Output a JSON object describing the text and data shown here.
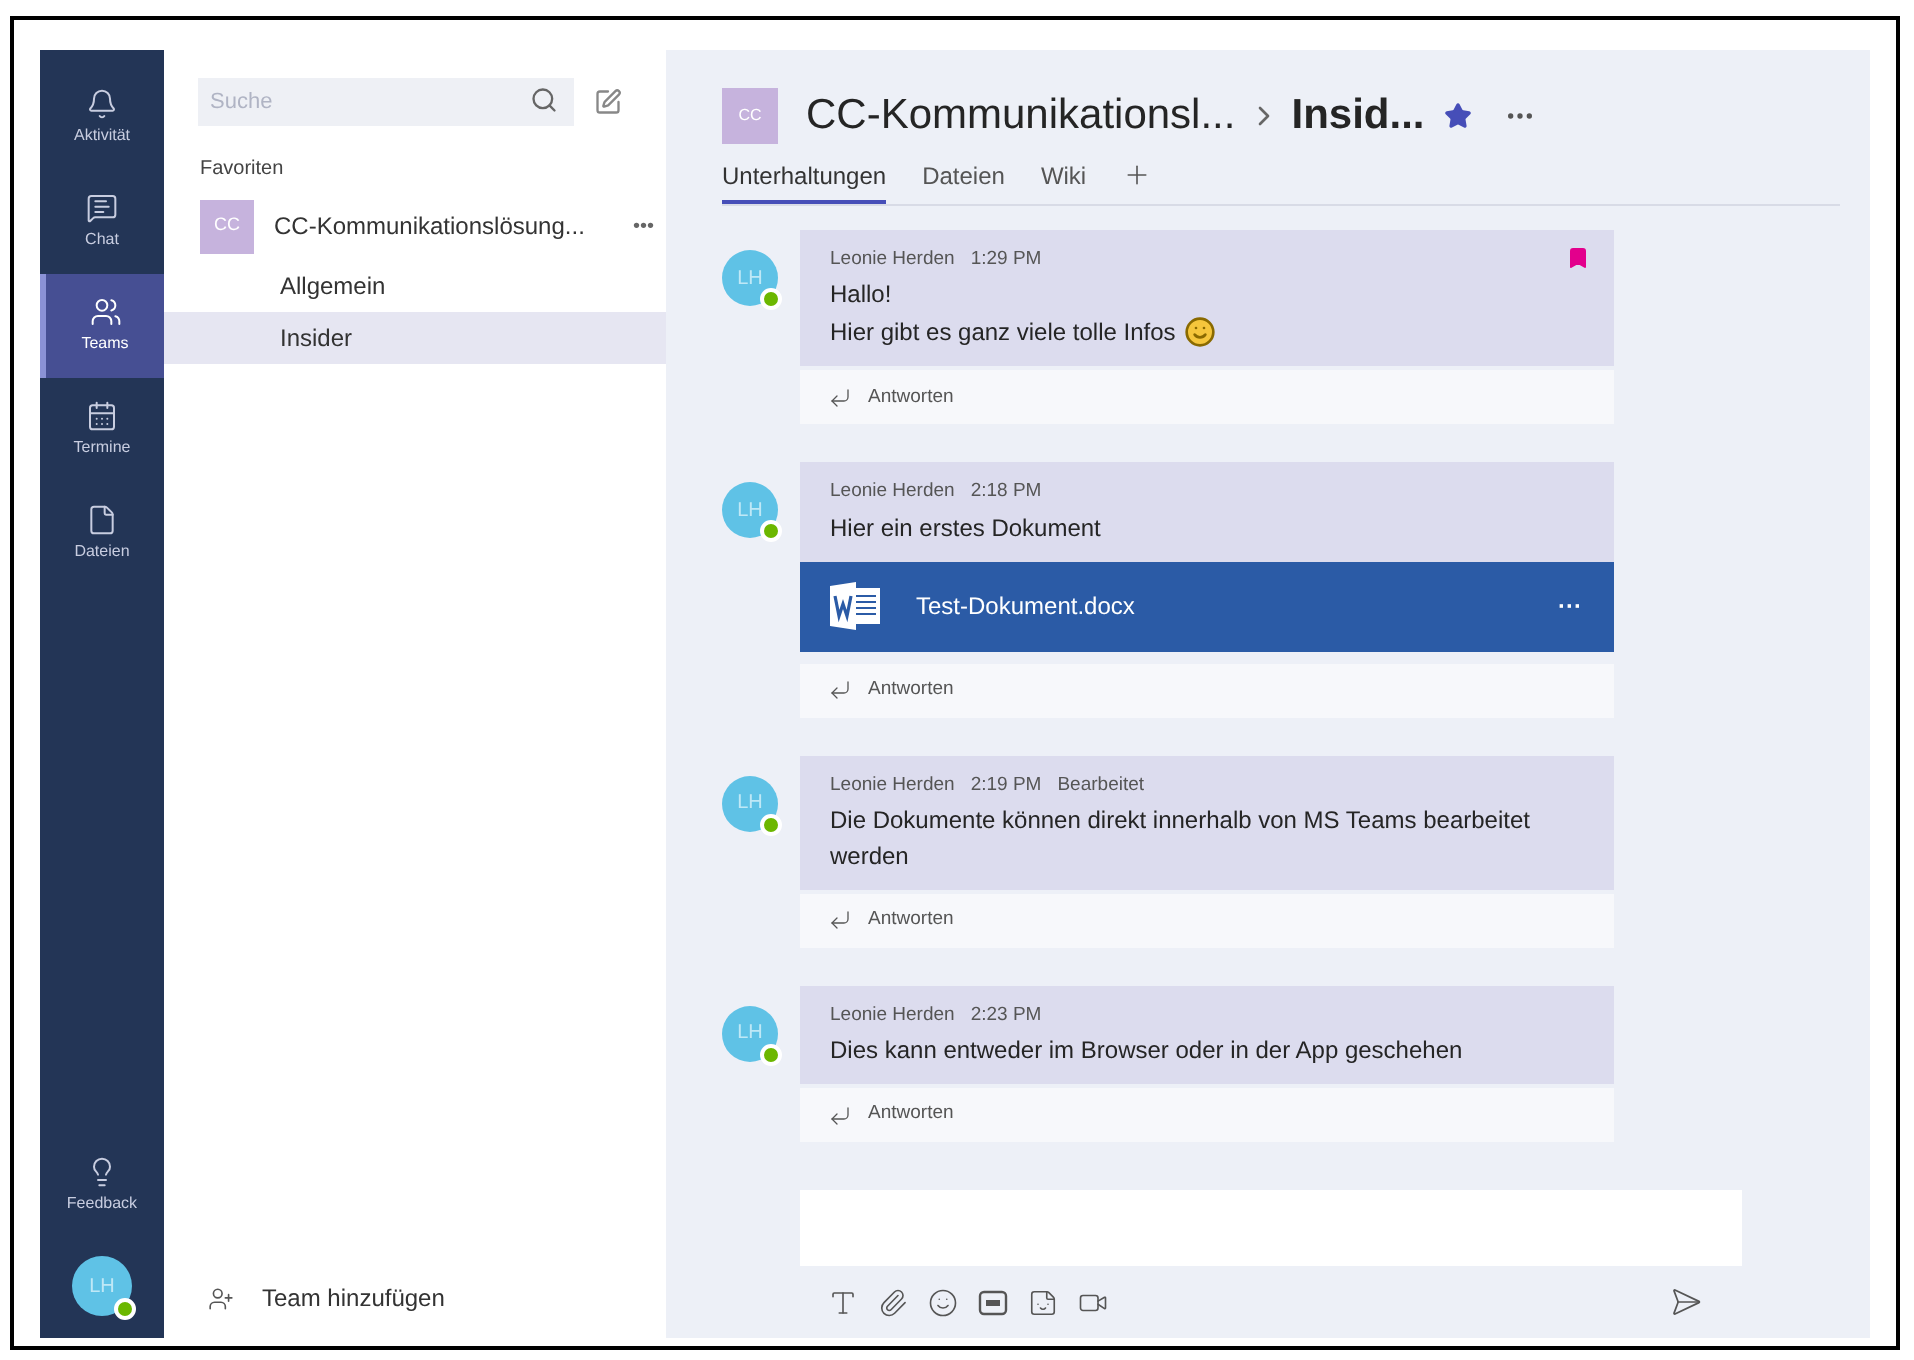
{
  "rail": {
    "items": [
      {
        "label": "Aktivität",
        "selected": false
      },
      {
        "label": "Chat",
        "selected": false
      },
      {
        "label": "Teams",
        "selected": true
      },
      {
        "label": "Termine",
        "selected": false
      },
      {
        "label": "Dateien",
        "selected": false
      }
    ],
    "feedback": "Feedback",
    "user": {
      "initials": "LH",
      "online": true
    }
  },
  "sidebar": {
    "search": {
      "placeholder": "Suche"
    },
    "section": "Favoriten",
    "team": {
      "initials": "CC",
      "name": "CC-Kommunikationslösung...",
      "more": "•••"
    },
    "channels": [
      {
        "name": "Allgemein",
        "selected": false
      },
      {
        "name": "Insider",
        "selected": true
      }
    ],
    "add_team": "Team hinzufügen"
  },
  "header": {
    "initials": "CC",
    "team": "CC-Kommunikationsl...",
    "channel": "Insid...",
    "favorite": true
  },
  "tabs": [
    {
      "label": "Unterhaltungen",
      "selected": true
    },
    {
      "label": "Dateien",
      "selected": false
    },
    {
      "label": "Wiki",
      "selected": false
    }
  ],
  "messages": [
    {
      "initials": "LH",
      "online": true,
      "author": "Leonie Herden",
      "time": "1:29 PM",
      "lines": [
        "Hallo!",
        "Hier gibt es ganz viele tolle Infos"
      ],
      "emoji": true,
      "bookmarked": true,
      "reply": "Antworten"
    },
    {
      "initials": "LH",
      "online": true,
      "author": "Leonie Herden",
      "time": "2:18 PM",
      "lines": [
        "Hier ein erstes Dokument"
      ],
      "emoji": false,
      "bookmarked": false,
      "attachment": {
        "name": "Test-Dokument.docx",
        "more": "···"
      },
      "reply": "Antworten"
    },
    {
      "initials": "LH",
      "online": true,
      "author": "Leonie Herden",
      "time": "2:19 PM",
      "edited": "Bearbeitet",
      "lines": [
        "Die Dokumente können direkt innerhalb von MS Teams bearbeitet werden"
      ],
      "emoji": false,
      "bookmarked": false,
      "reply": "Antworten"
    },
    {
      "initials": "LH",
      "online": true,
      "author": "Leonie Herden",
      "time": "2:23 PM",
      "lines": [
        "Dies kann entweder im Browser oder in der App geschehen"
      ],
      "emoji": false,
      "bookmarked": false,
      "reply": "Antworten"
    }
  ]
}
